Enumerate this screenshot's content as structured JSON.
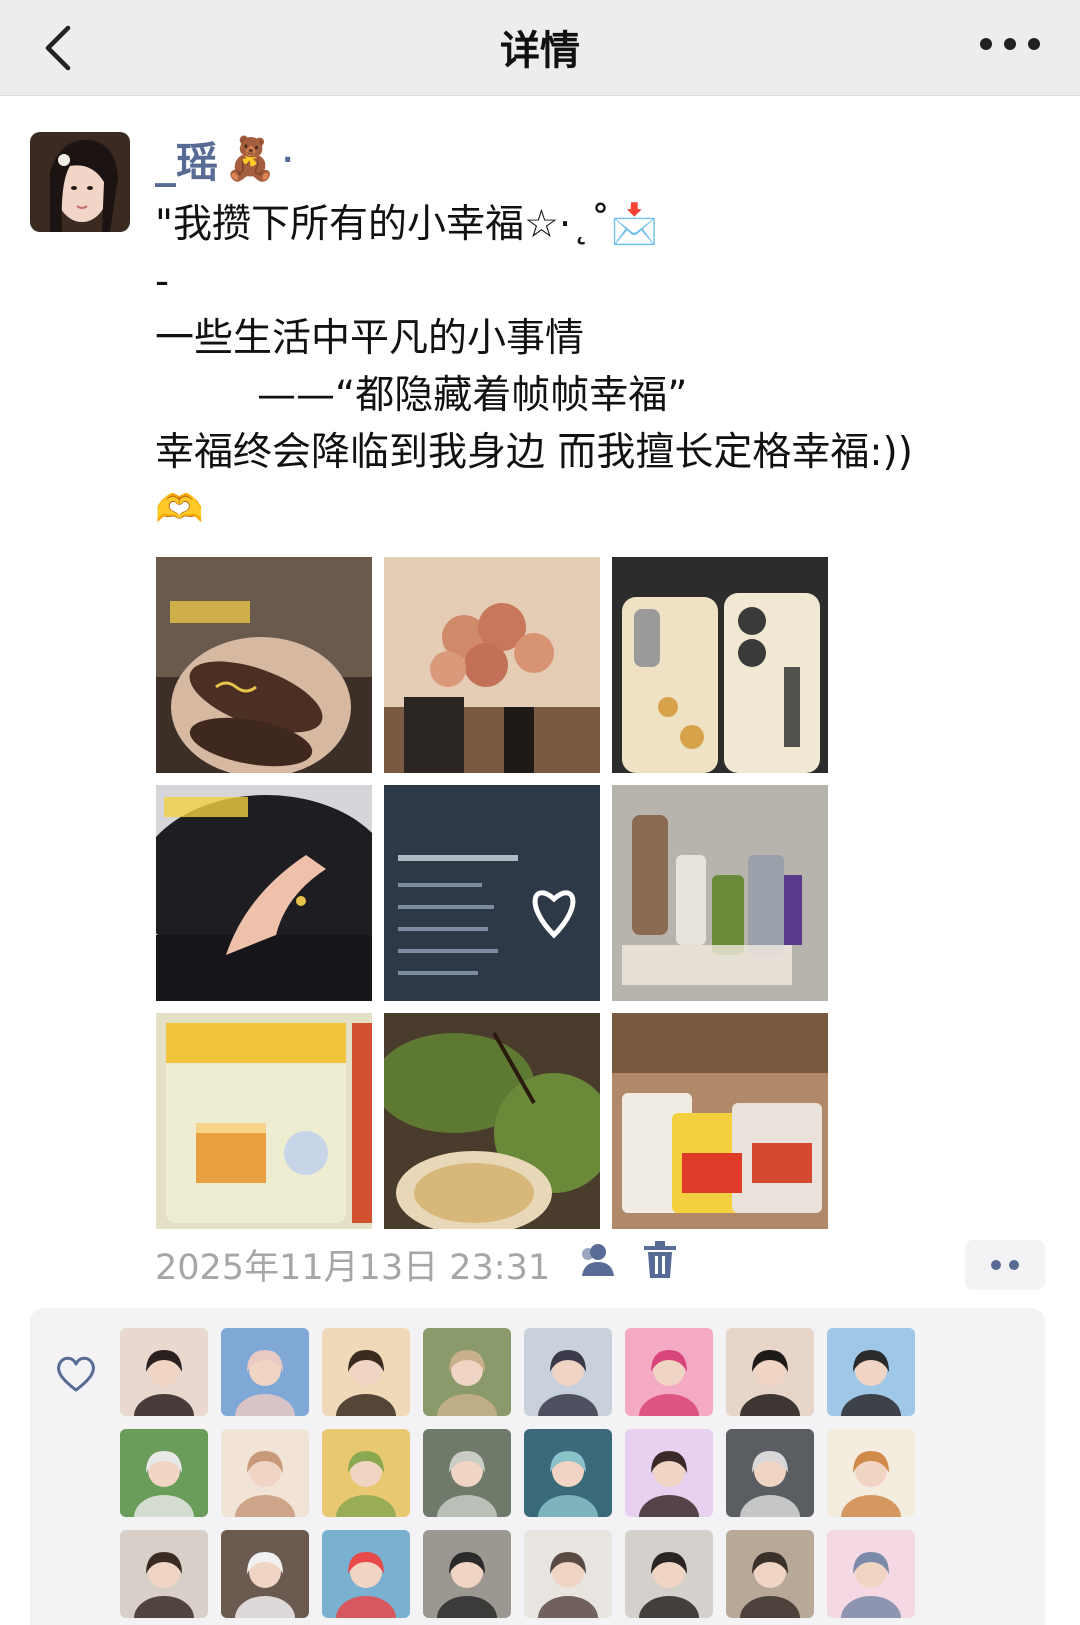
{
  "nav": {
    "title": "详情",
    "back_icon": "chevron-left-icon",
    "more_icon": "more-horizontal-icon"
  },
  "author": {
    "name": "_瑶",
    "emoji": "🧸",
    "suffix": "·"
  },
  "post": {
    "lines": [
      "\"我攒下所有的小幸福☆·˛˚📩",
      "-",
      "一些生活中平凡的小事情",
      "——“都隐藏着帧帧幸福”",
      "幸福终会降临到我身边 而我擅长定格幸福:))",
      "🫶"
    ]
  },
  "photos": [
    {
      "name": "photo-hairclips",
      "bg": "#3e2c22",
      "accent": "#6b4a37"
    },
    {
      "name": "photo-roses",
      "bg": "#d9b89a",
      "accent": "#c97a5c"
    },
    {
      "name": "photo-phone-cases",
      "bg": "#3a3a3a",
      "accent": "#e9d9b6"
    },
    {
      "name": "photo-hand-ring",
      "bg": "#2a2a2e",
      "accent": "#e6b9a2"
    },
    {
      "name": "photo-text-heart",
      "bg": "#2f3a4a",
      "accent": "#9fb0c4"
    },
    {
      "name": "photo-skincare",
      "bg": "#bdbab5",
      "accent": "#e8e4dc"
    },
    {
      "name": "photo-snack-pack",
      "bg": "#ece9c8",
      "accent": "#f2b83c"
    },
    {
      "name": "photo-dinner",
      "bg": "#4f5a2e",
      "accent": "#86a64a"
    },
    {
      "name": "photo-spicy-snacks",
      "bg": "#b88f6e",
      "accent": "#e0452a"
    }
  ],
  "meta": {
    "timestamp": "2025年11月13日 23:31",
    "visibility_icon": "friends-icon",
    "delete_icon": "trash-icon",
    "more_icon": "two-dots-icon"
  },
  "likes": {
    "heart_icon": "heart-outline-icon",
    "avatars": [
      {
        "name": "liker-avatar-1",
        "bg": "#e8d8d0",
        "accent": "#2b2020"
      },
      {
        "name": "liker-avatar-2",
        "bg": "#7fa8d6",
        "accent": "#e8c9c4"
      },
      {
        "name": "liker-avatar-3",
        "bg": "#f0d9b8",
        "accent": "#3a2a20"
      },
      {
        "name": "liker-avatar-4",
        "bg": "#8a9a6a",
        "accent": "#c8b08a"
      },
      {
        "name": "liker-avatar-5",
        "bg": "#c9d2dc",
        "accent": "#3a3a4a"
      },
      {
        "name": "liker-avatar-6",
        "bg": "#f4a9c4",
        "accent": "#d8457a"
      },
      {
        "name": "liker-avatar-7",
        "bg": "#e6d5c8",
        "accent": "#1e1a18"
      },
      {
        "name": "liker-avatar-8",
        "bg": "#9ec7e8",
        "accent": "#2a2a2a"
      },
      {
        "name": "liker-avatar-9",
        "bg": "#6a9c5a",
        "accent": "#e8e8e8"
      },
      {
        "name": "liker-avatar-10",
        "bg": "#f1e3d6",
        "accent": "#c89a7a"
      },
      {
        "name": "liker-avatar-11",
        "bg": "#e8c870",
        "accent": "#8aa850"
      },
      {
        "name": "liker-avatar-12",
        "bg": "#6f7a6a",
        "accent": "#c8ccc4"
      },
      {
        "name": "liker-avatar-13",
        "bg": "#3a6a7a",
        "accent": "#8ac0c8"
      },
      {
        "name": "liker-avatar-14",
        "bg": "#e8d0f0",
        "accent": "#3a2a2a"
      },
      {
        "name": "liker-avatar-15",
        "bg": "#5a5e62",
        "accent": "#d8d8d8"
      },
      {
        "name": "liker-avatar-16",
        "bg": "#f5ece0",
        "accent": "#d08a4a"
      },
      {
        "name": "liker-avatar-17",
        "bg": "#d8cfc8",
        "accent": "#3a2a24"
      },
      {
        "name": "liker-avatar-18",
        "bg": "#6a5a50",
        "accent": "#f0f0f0"
      },
      {
        "name": "liker-avatar-19",
        "bg": "#7ab0d0",
        "accent": "#e84a4a"
      },
      {
        "name": "liker-avatar-20",
        "bg": "#9a9890",
        "accent": "#2a2a2a"
      },
      {
        "name": "liker-avatar-21",
        "bg": "#e8e4e0",
        "accent": "#5a4a44"
      },
      {
        "name": "liker-avatar-22",
        "bg": "#d4d0cc",
        "accent": "#2a2422"
      },
      {
        "name": "liker-avatar-23",
        "bg": "#b8a898",
        "accent": "#3a302a"
      },
      {
        "name": "liker-avatar-24",
        "bg": "#f4d8e4",
        "accent": "#7a8aa8"
      }
    ]
  }
}
